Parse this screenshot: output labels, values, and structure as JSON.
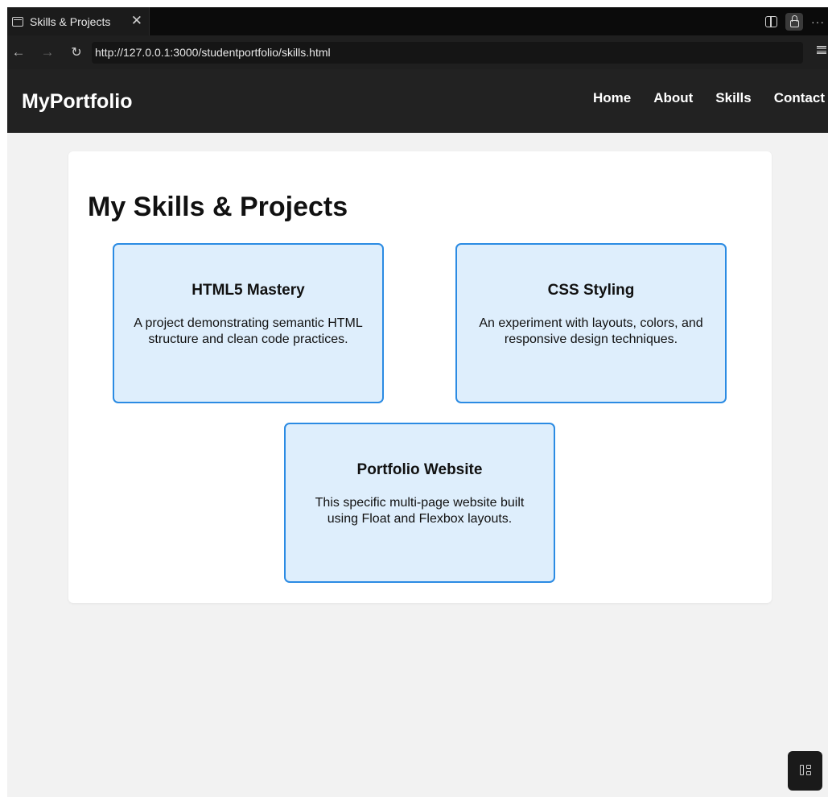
{
  "browser": {
    "tab_title": "Skills & Projects",
    "url": "http://127.0.0.1:3000/studentportfolio/skills.html",
    "icons": [
      "page-icon",
      "close-icon",
      "split-view-icon",
      "lock-icon",
      "more-icon",
      "back-icon",
      "forward-icon",
      "reload-icon",
      "menu-icon"
    ]
  },
  "header": {
    "logo": "MyPortfolio",
    "nav": [
      {
        "label": "Home"
      },
      {
        "label": "About"
      },
      {
        "label": "Skills"
      },
      {
        "label": "Contact"
      }
    ]
  },
  "main": {
    "title": "My Skills & Projects",
    "projects": [
      {
        "title": "HTML5 Mastery",
        "description": "A project demonstrating semantic HTML structure and clean code practices."
      },
      {
        "title": "CSS Styling",
        "description": "An experiment with layouts, colors, and responsive design techniques."
      },
      {
        "title": "Portfolio Website",
        "description": "This specific multi-page website built using Float and Flexbox layouts."
      }
    ]
  },
  "colors": {
    "header_bg": "#222222",
    "card_bg": "#deeefc",
    "card_border": "#2b8be3",
    "page_bg": "#f2f2f2"
  }
}
